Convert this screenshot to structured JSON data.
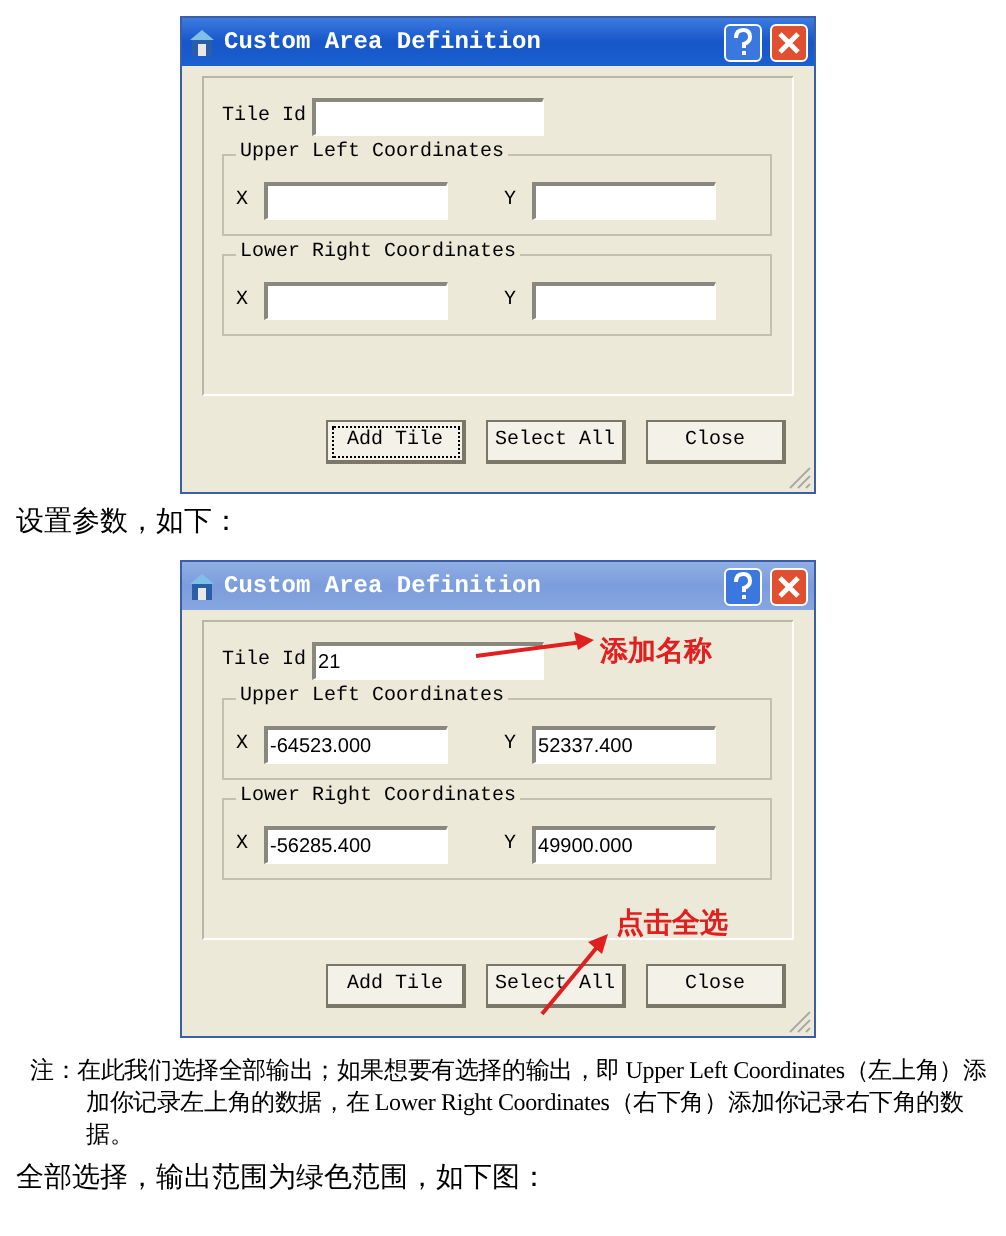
{
  "dialogs": [
    {
      "title": "Custom Area Definition",
      "active": true,
      "tile_id": {
        "label": "Tile Id"
      },
      "groups": [
        {
          "title": "Upper Left Coordinates",
          "fields": [
            {
              "label": "X"
            },
            {
              "label": "Y"
            }
          ]
        },
        {
          "title": "Lower Right Coordinates",
          "fields": [
            {
              "label": "X"
            },
            {
              "label": "Y"
            }
          ]
        }
      ],
      "buttons": [
        {
          "label": "Add Tile",
          "focused": true
        },
        {
          "label": "Select All",
          "focused": false
        },
        {
          "label": "Close",
          "focused": false
        }
      ]
    },
    {
      "title": "Custom Area Definition",
      "active": false,
      "tile_id": {
        "label": "Tile Id",
        "value": "21"
      },
      "groups": [
        {
          "title": "Upper Left Coordinates",
          "fields": [
            {
              "label": "X",
              "value": "-64523.000"
            },
            {
              "label": "Y",
              "value": "52337.400"
            }
          ]
        },
        {
          "title": "Lower Right Coordinates",
          "fields": [
            {
              "label": "X",
              "value": "-56285.400"
            },
            {
              "label": "Y",
              "value": "49900.000"
            }
          ]
        }
      ],
      "buttons": [
        {
          "label": "Add Tile",
          "focused": false
        },
        {
          "label": "Select All",
          "focused": false
        },
        {
          "label": "Close",
          "focused": false
        }
      ],
      "annotations": [
        {
          "kind": "tile-id",
          "text": "添加名称"
        },
        {
          "kind": "select-all",
          "text": "点击全选"
        }
      ]
    }
  ],
  "paragraphs": [
    {
      "kind": "plain",
      "text": "设置参数，如下："
    },
    {
      "kind": "note",
      "text": "注：在此我们选择全部输出；如果想要有选择的输出，即 Upper Left Coordinates（左上角）添加你记录左上角的数据，在 Lower Right Coordinates（右下角）添加你记录右下角的数据。"
    },
    {
      "kind": "plain",
      "text": "全部选择，输出范围为绿色范围，如下图："
    }
  ]
}
